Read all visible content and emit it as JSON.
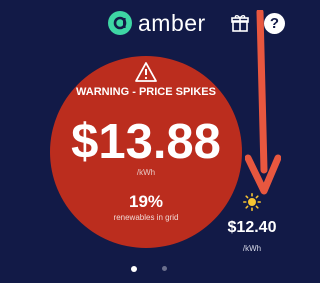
{
  "header": {
    "brand": "amber",
    "logo_icon": "amber-logo-icon",
    "gift_icon": "gift-icon",
    "help_label": "?"
  },
  "price_panel": {
    "warning_icon": "warning-triangle-icon",
    "warning": "WARNING - PRICE SPIKES",
    "price": "$13.88",
    "unit": "/kWh",
    "renewables_pct": "19%",
    "renewables_label": "renewables in grid",
    "color": "#bb2d1e"
  },
  "forecast": {
    "icon": "sun-icon",
    "price": "$12.40",
    "unit": "/kWh"
  },
  "annotation": {
    "icon": "down-arrow-icon",
    "color": "#e8573f"
  },
  "pager": {
    "pages": 2,
    "active": 1
  },
  "colors": {
    "background": "#121a47",
    "accent": "#3ed6a4",
    "sun": "#f6c431"
  }
}
